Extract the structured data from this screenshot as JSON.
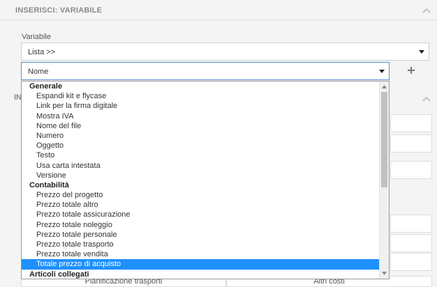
{
  "panel": {
    "title": "INSERISCI: VARIABILE"
  },
  "variable": {
    "label": "Variabile",
    "value": "Lista >>"
  },
  "name_select": {
    "value": "Nome"
  },
  "section2": {
    "visible_text": "IN"
  },
  "dropdown": {
    "groups": [
      {
        "label": "Generale",
        "options": [
          "Espandi kit e flycase",
          "Link per la firma digitale",
          "Mostra IVA",
          "Nome del file",
          "Numero",
          "Oggetto",
          "Testo",
          "Usa carta intestata",
          "Versione"
        ]
      },
      {
        "label": "Contabilità",
        "options": [
          "Prezzo del progetto",
          "Prezzo totale altro",
          "Prezzo totale assicurazione",
          "Prezzo totale noleggio",
          "Prezzo totale personale",
          "Prezzo totale trasporto",
          "Prezzo totale vendita",
          "Totale prezzo di acquisto"
        ]
      },
      {
        "label": "Articoli collegati",
        "options": []
      }
    ],
    "selected": "Totale prezzo di acquisto"
  },
  "bottom": {
    "left_label": "Pianificazione trasporti",
    "right_label": "Altri costi"
  },
  "colors": {
    "selected_bg": "#1e90ff",
    "focus_border": "#5b8fd6"
  }
}
